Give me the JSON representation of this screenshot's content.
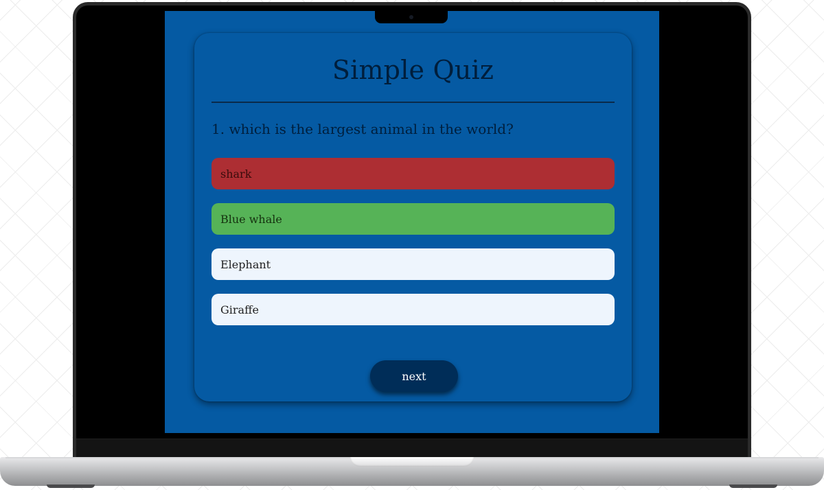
{
  "quiz": {
    "title": "Simple Quiz",
    "question": "1. which is the largest animal in the world?",
    "answers": [
      {
        "text": "shark",
        "state": "incorrect",
        "color": "#ad2e33"
      },
      {
        "text": "Blue whale",
        "state": "correct",
        "color": "#56b357"
      },
      {
        "text": "Elephant",
        "state": "default",
        "color": "#eef5fd"
      },
      {
        "text": "Giraffe",
        "state": "default",
        "color": "#eef5fd"
      }
    ],
    "next_label": "next"
  },
  "colors": {
    "screen_background": "#055aa3",
    "title_text": "#001e3c",
    "next_button": "#002d58"
  }
}
